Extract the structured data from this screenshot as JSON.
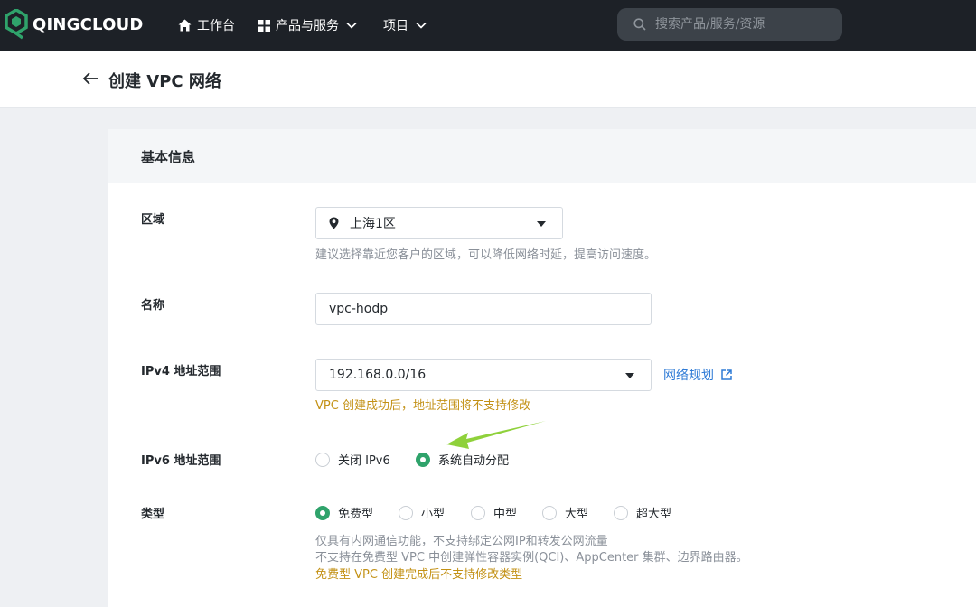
{
  "nav": {
    "brand": "QINGCLOUD",
    "workbench": "工作台",
    "products": "产品与服务",
    "projects": "项目",
    "search_placeholder": "搜索产品/服务/资源"
  },
  "page": {
    "title": "创建 VPC 网络"
  },
  "section": {
    "title": "基本信息"
  },
  "form": {
    "region": {
      "label": "区域",
      "value": "上海1区",
      "hint": "建议选择靠近您客户的区域，可以降低网络时延，提高访问速度。"
    },
    "name": {
      "label": "名称",
      "value": "vpc-hodp"
    },
    "ipv4": {
      "label": "IPv4 地址范围",
      "value": "192.168.0.0/16",
      "link": "网络规划",
      "warning": "VPC 创建成功后，地址范围将不支持修改"
    },
    "ipv6": {
      "label": "IPv6 地址范围",
      "options": [
        "关闭 IPv6",
        "系统自动分配"
      ],
      "selected": "系统自动分配"
    },
    "type": {
      "label": "类型",
      "options": [
        "免费型",
        "小型",
        "中型",
        "大型",
        "超大型"
      ],
      "selected": "免费型",
      "hint1": "仅具有内网通信功能，不支持绑定公网IP和转发公网流量",
      "hint2": "不支持在免费型 VPC 中创建弹性容器实例(QCI)、AppCenter 集群、边界路由器。",
      "warning": "免费型 VPC 创建完成后不支持修改类型"
    }
  },
  "colors": {
    "accent_green": "#2fa36b",
    "link_blue": "#2f7bd6",
    "warning_gold": "#c39115",
    "annotation_arrow": "#8fd13b"
  }
}
